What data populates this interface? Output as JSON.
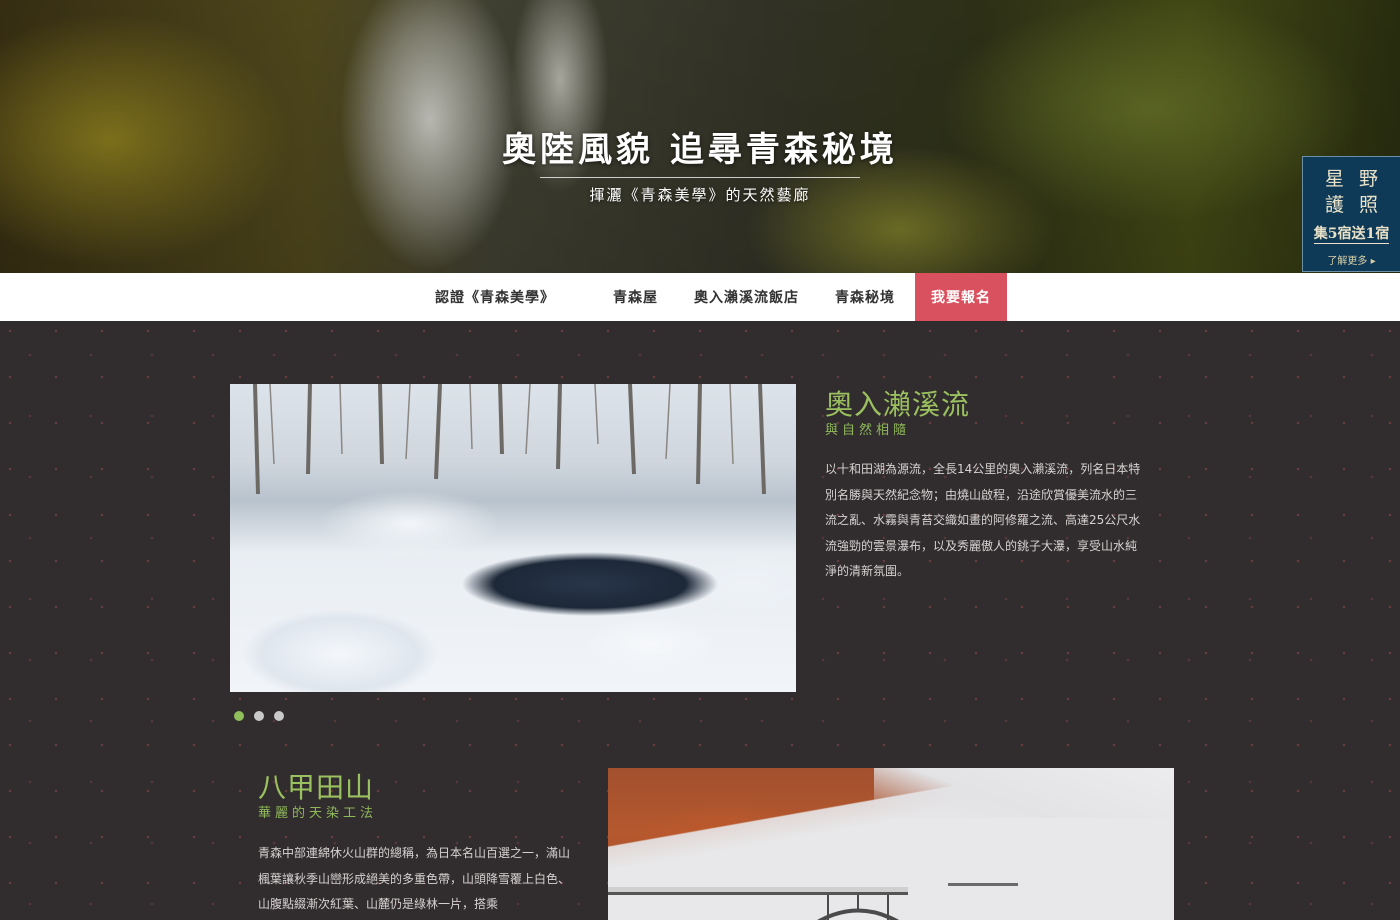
{
  "hero": {
    "title": "奧陸風貌 追尋青森秘境",
    "subtitle": "揮灑《青森美學》的天然藝廊"
  },
  "badge": {
    "chars": [
      "星",
      "野",
      "護",
      "照"
    ],
    "promo": "集5宿送1宿",
    "more": "了解更多 ▸"
  },
  "nav": {
    "items": [
      "認證《青森美學》",
      "青森屋",
      "奧入瀨溪流飯店",
      "青森秘境"
    ],
    "cta": "我要報名"
  },
  "sections": [
    {
      "title": "奧入瀨溪流",
      "subtitle": "與自然相隨",
      "body": "以十和田湖為源流，全長14公里的奧入瀨溪流，列名日本特別名勝與天然紀念物；由燒山啟程，沿途欣賞優美流水的三流之亂、水霧與青苔交織如畫的阿修羅之流、高達25公尺水流強勁的雲景瀑布，以及秀麗傲人的銚子大瀑，享受山水純淨的清新氛圍。"
    },
    {
      "title": "八甲田山",
      "subtitle": "華麗的天染工法",
      "body": "青森中部連綿休火山群的總稱，為日本名山百選之一，滿山楓葉讓秋季山巒形成絕美的多重色帶，山頭降雪覆上白色、山腹點綴漸次紅葉、山麓仍是綠林一片，搭乘"
    }
  ],
  "carousel": {
    "count": 3,
    "active": 0
  },
  "colors": {
    "accent_green": "#9ac05f",
    "cta_red": "#d9505e",
    "background": "#312d2e",
    "badge_blue": "#0f3a57"
  }
}
